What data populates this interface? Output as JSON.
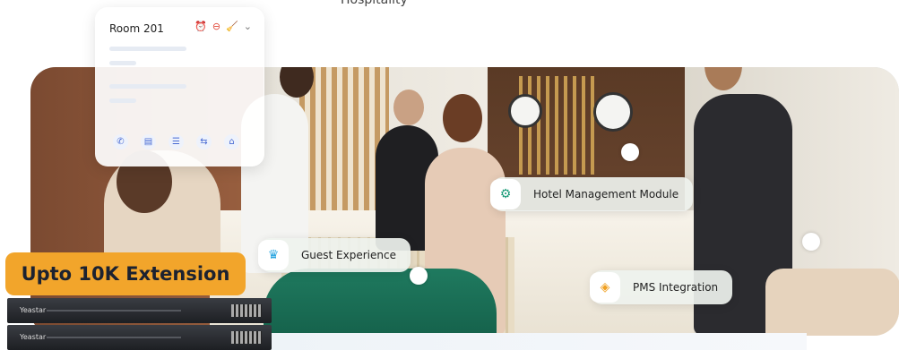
{
  "caption": "Hospitality",
  "room_card": {
    "title": "Room 201",
    "status_icons": [
      "alarm-clock-icon",
      "do-not-disturb-icon",
      "cleaning-icon",
      "chevron-down-icon"
    ],
    "actions": [
      "phone-icon",
      "notes-icon",
      "document-icon",
      "transfer-icon",
      "home-icon"
    ]
  },
  "chips": {
    "hotel": "Hotel Management Module",
    "guest": "Guest Experience",
    "pms": "PMS Integration"
  },
  "badge": "Upto 10K Extension",
  "device": {
    "brand": "Yeastar"
  },
  "colors": {
    "badge": "#f2a52b",
    "chip_icon": "#1a9a77",
    "pms_icon": "#f0a020",
    "guest_icon": "#2aa5e0"
  }
}
